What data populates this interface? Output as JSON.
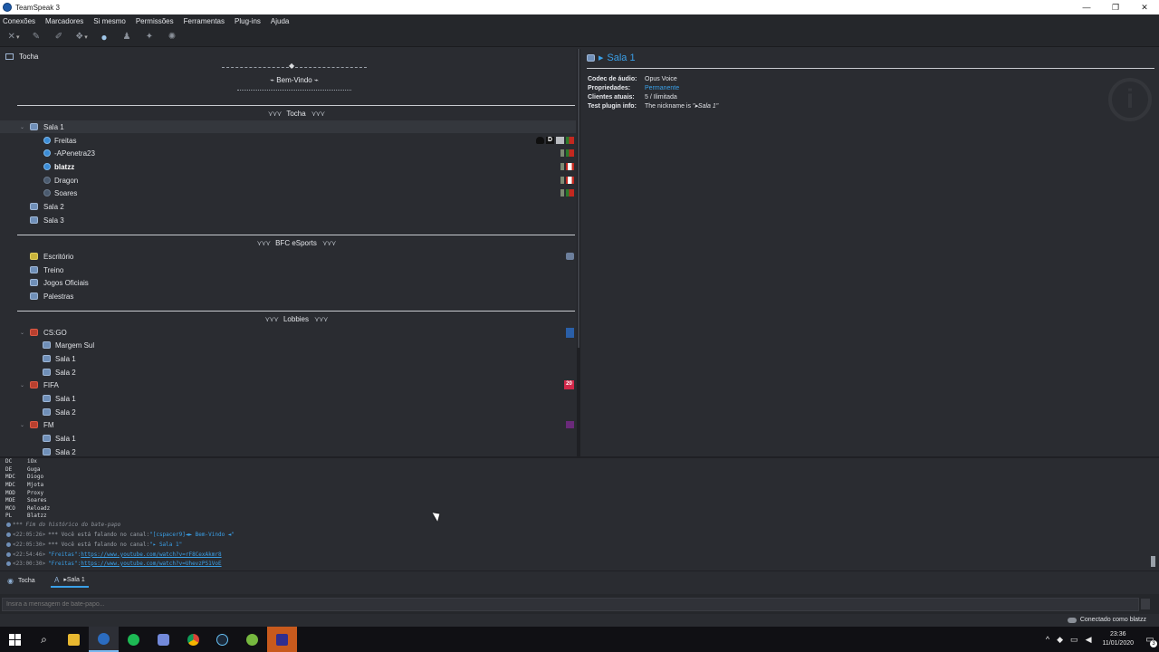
{
  "window": {
    "title": "TeamSpeak 3",
    "controls": [
      "—",
      "❐",
      "✕"
    ]
  },
  "menu": [
    "Conexões",
    "Marcadores",
    "Si mesmo",
    "Permissões",
    "Ferramentas",
    "Plug-ins",
    "Ajuda"
  ],
  "toolbar": {
    "icons": [
      "disconnect-icon",
      "bookmark-icon",
      "connect-icon",
      "away-icon",
      "chat-bubble-icon",
      "avatar-icon",
      "wolf-icon",
      "snowflake-icon"
    ]
  },
  "server": {
    "name": "Tocha",
    "welcome": "Bem-Vindo"
  },
  "tree": {
    "spacer1": "Tocha",
    "spacer2": "BFC eSports",
    "spacer3": "Lobbies",
    "group1": [
      {
        "label": "Sala 1"
      },
      {
        "label": "Freitas"
      },
      {
        "label": "-APenetra23"
      },
      {
        "label": "blatzz"
      },
      {
        "label": "Dragon"
      },
      {
        "label": "Soares"
      },
      {
        "label": "Sala 2"
      },
      {
        "label": "Sala 3"
      }
    ],
    "group2": [
      {
        "label": "Escritório"
      },
      {
        "label": "Treino"
      },
      {
        "label": "Jogos Oficiais"
      },
      {
        "label": "Palestras"
      }
    ],
    "group3": [
      {
        "label": "CS:GO"
      },
      {
        "label": "Margem Sul"
      },
      {
        "label": "Sala 1"
      },
      {
        "label": "Sala 2"
      },
      {
        "label": "FIFA"
      },
      {
        "label": "Sala 1"
      },
      {
        "label": "Sala 2"
      },
      {
        "label": "FM"
      },
      {
        "label": "Sala 1"
      },
      {
        "label": "Sala 2"
      }
    ],
    "fifa_badge": "20",
    "freitas_badge": "D"
  },
  "info": {
    "title": "Sala 1",
    "rows": [
      {
        "k": "Codec de áudio:",
        "v": "Opus Voice"
      },
      {
        "k": "Propriedades:",
        "v": "Permanente"
      },
      {
        "k": "Clientes atuais:",
        "v": "5 / Ilimitada"
      },
      {
        "k": "Test plugin info:",
        "v": "The nickname is ",
        "v2": "\"▸Sala 1\""
      }
    ]
  },
  "chat": {
    "tags": [
      {
        "tag": "DC",
        "name": "iOx"
      },
      {
        "tag": "DE",
        "name": "Guga"
      },
      {
        "tag": "MDC",
        "name": "Diogo"
      },
      {
        "tag": "MDC",
        "name": "Mjota"
      },
      {
        "tag": "MOD",
        "name": "Proxy"
      },
      {
        "tag": "MOE",
        "name": "Soares"
      },
      {
        "tag": "MCO",
        "name": "Reloadz"
      },
      {
        "tag": "PL",
        "name": "Blatzz"
      }
    ],
    "history_end": "*** Fim do histórico do bate-papo",
    "line1_ts": "<22:05:26>",
    "line1_msg": "*** Você está falando no canal: ",
    "line1_chan": "\"[cspacer9]◄►     Bem-Vindo     ◄\"",
    "line2_ts": "<22:05:30>",
    "line2_msg": "*** Você está falando no canal: ",
    "line2_chan": "\"▸ Sala 1\"",
    "line3_ts": "<22:54:46>",
    "line3_name": "\"Freitas\": ",
    "line3_url": "https://www.youtube.com/watch?v=rF8CexAkmr8",
    "line4_ts": "<23:00:30>",
    "line4_name": "\"Freitas\": ",
    "line4_url": "https://www.youtube.com/watch?v=UhevzPS1VoE"
  },
  "tabs": [
    {
      "label": "Tocha"
    },
    {
      "label": "▸Sala 1"
    }
  ],
  "input": {
    "placeholder": "Insira a mensagem de bate-papo..."
  },
  "status": {
    "text": "Conectado como blatzz"
  },
  "taskbar": {
    "apps": [
      "windows-start-icon",
      "search-icon",
      "file-explorer-icon",
      "teamspeak-icon",
      "spotify-icon",
      "discord-icon",
      "chrome-icon",
      "steam-icon",
      "utorrent-icon",
      "obs-icon"
    ],
    "time": "23:36",
    "date": "11/01/2020",
    "notifications": "3"
  },
  "colors": {
    "accent": "#3aa0e8",
    "panel": "#2a2c31",
    "toolbar": "#25272b"
  }
}
